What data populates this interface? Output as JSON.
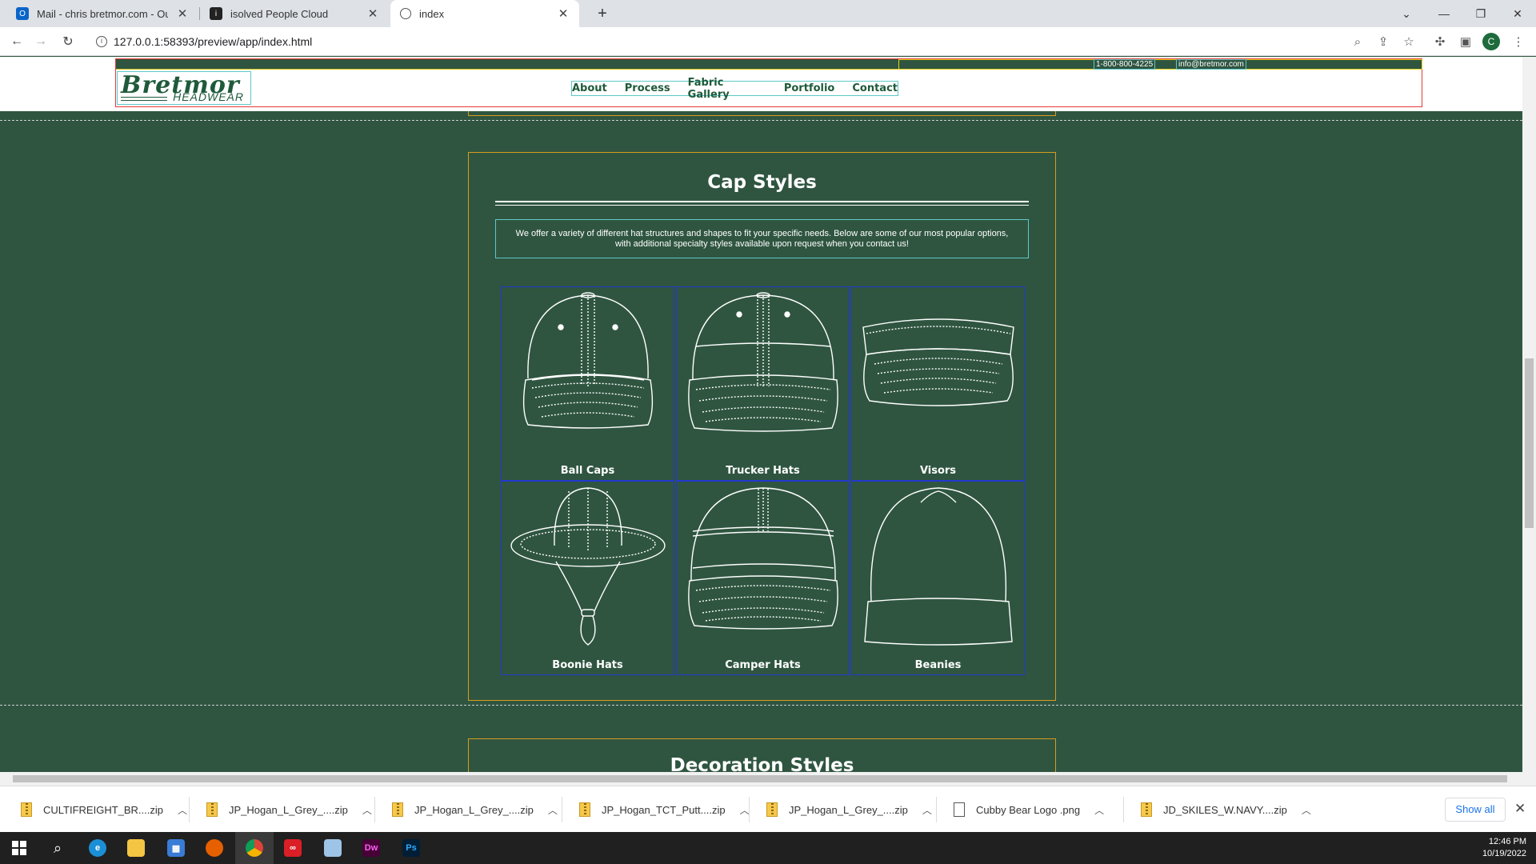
{
  "browser": {
    "tabs": [
      {
        "title": "Mail - chris bretmor.com - Outlo",
        "icon": "outlook-icon"
      },
      {
        "title": "isolved People Cloud",
        "icon": "isolved-icon"
      },
      {
        "title": "index",
        "icon": "globe-icon"
      }
    ],
    "url": "127.0.0.1:58393/preview/app/index.html",
    "profile_initial": "C"
  },
  "site": {
    "phone": "1-800-800-4225",
    "email": "info@bretmor.com",
    "logo_top": "Bretmor",
    "logo_bottom": "HEADWEAR",
    "nav": [
      "About",
      "Process",
      "Fabric Gallery",
      "Portfolio",
      "Contact"
    ],
    "section_title": "Cap Styles",
    "intro": "We offer a variety of different hat structures and shapes to fit your specific needs. Below are some of our most popular options, with additional specialty styles available upon request when you contact us!",
    "styles": [
      "Ball Caps",
      "Trucker Hats",
      "Visors",
      "Boonie Hats",
      "Camper Hats",
      "Beanies"
    ],
    "next_section_title": "Decoration Styles"
  },
  "colors": {
    "page_bg": "#2f5540",
    "brand_green": "#1e5a3a",
    "card_border": "#d89c1c",
    "cell_border": "#2238d0"
  },
  "downloads": {
    "items": [
      {
        "name": "CULTIFREIGHT_BR....zip",
        "type": "zip"
      },
      {
        "name": "JP_Hogan_L_Grey_....zip",
        "type": "zip"
      },
      {
        "name": "JP_Hogan_L_Grey_....zip",
        "type": "zip"
      },
      {
        "name": "JP_Hogan_TCT_Putt....zip",
        "type": "zip"
      },
      {
        "name": "JP_Hogan_L_Grey_....zip",
        "type": "zip"
      },
      {
        "name": "Cubby Bear Logo .png",
        "type": "png"
      },
      {
        "name": "JD_SKILES_W.NAVY....zip",
        "type": "zip"
      }
    ],
    "show_all": "Show all"
  },
  "taskbar": {
    "apps": [
      "windows-start",
      "search",
      "edge",
      "file-explorer",
      "store",
      "firefox",
      "chrome",
      "creative-cloud",
      "notepad",
      "dreamweaver",
      "photoshop"
    ],
    "dw_label": "Dw",
    "ps_label": "Ps",
    "time": "12:46 PM",
    "date": "10/19/2022"
  }
}
